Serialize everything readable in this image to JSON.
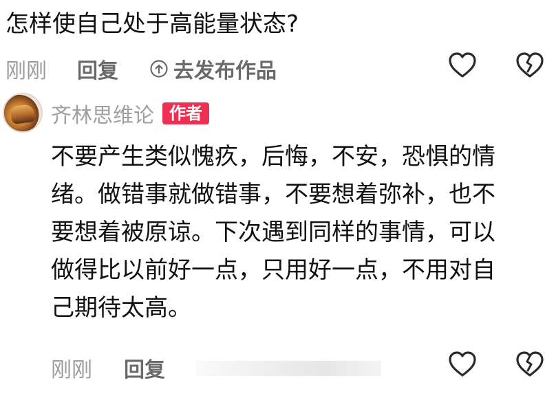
{
  "question": {
    "text": "怎样使自己处于高能量状态?"
  },
  "top_actions": {
    "time": "刚刚",
    "reply": "回复",
    "publish": "去发布作品",
    "publish_icon": "arrow-up-circle-icon",
    "like_icon": "heart-outline-icon",
    "dislike_icon": "broken-heart-icon"
  },
  "comment": {
    "author": "齐林思维论",
    "badge": "作者",
    "avatar_icon": "avatar-image",
    "lines": [
      "不要产生类似愧疚，后悔，不安，恐惧的情",
      "绪。做错事就做错事，不要想着弥补，也不",
      "要想着被原谅。下次遇到同样的事情，可以",
      "做得比以前好一点，只用好一点，不用对自",
      "己期待太高。"
    ],
    "time": "刚刚",
    "reply": "回复"
  },
  "colors": {
    "badge": "#ee2f53",
    "meta_text": "#9c9c9c",
    "action_text": "#6a6a6a",
    "body_text": "#111111"
  }
}
